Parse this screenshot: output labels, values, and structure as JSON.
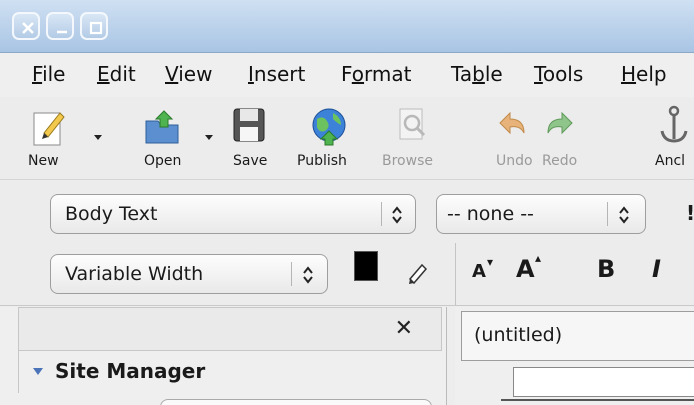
{
  "menubar": {
    "items": [
      {
        "pre": "",
        "ul": "F",
        "post": "ile"
      },
      {
        "pre": "",
        "ul": "E",
        "post": "dit"
      },
      {
        "pre": "",
        "ul": "V",
        "post": "iew"
      },
      {
        "pre": "",
        "ul": "I",
        "post": "nsert"
      },
      {
        "pre": "F",
        "ul": "o",
        "post": "rmat"
      },
      {
        "pre": "Ta",
        "ul": "b",
        "post": "le"
      },
      {
        "pre": "",
        "ul": "T",
        "post": "ools"
      },
      {
        "pre": "",
        "ul": "H",
        "post": "elp"
      }
    ]
  },
  "toolbar": {
    "new_label": "New",
    "open_label": "Open",
    "save_label": "Save",
    "publish_label": "Publish",
    "browse_label": "Browse",
    "undo_label": "Undo",
    "redo_label": "Redo",
    "anchor_label": "Ancl"
  },
  "format": {
    "paragraph_style": "Body Text",
    "class_style": "-- none --",
    "font": "Variable Width",
    "bold_label": "B",
    "italic_label": "I",
    "smaller_label": "A",
    "larger_label": "A",
    "cut_label": "!"
  },
  "sidebar": {
    "title": "Site Manager",
    "close_glyph": "✕"
  },
  "editor": {
    "tab_title": "(untitled)"
  },
  "colors": {
    "titlebar": "#b9d1ea",
    "text_color": "#000000",
    "bg_color": "#ffffff",
    "accent": "#4a73b8"
  }
}
